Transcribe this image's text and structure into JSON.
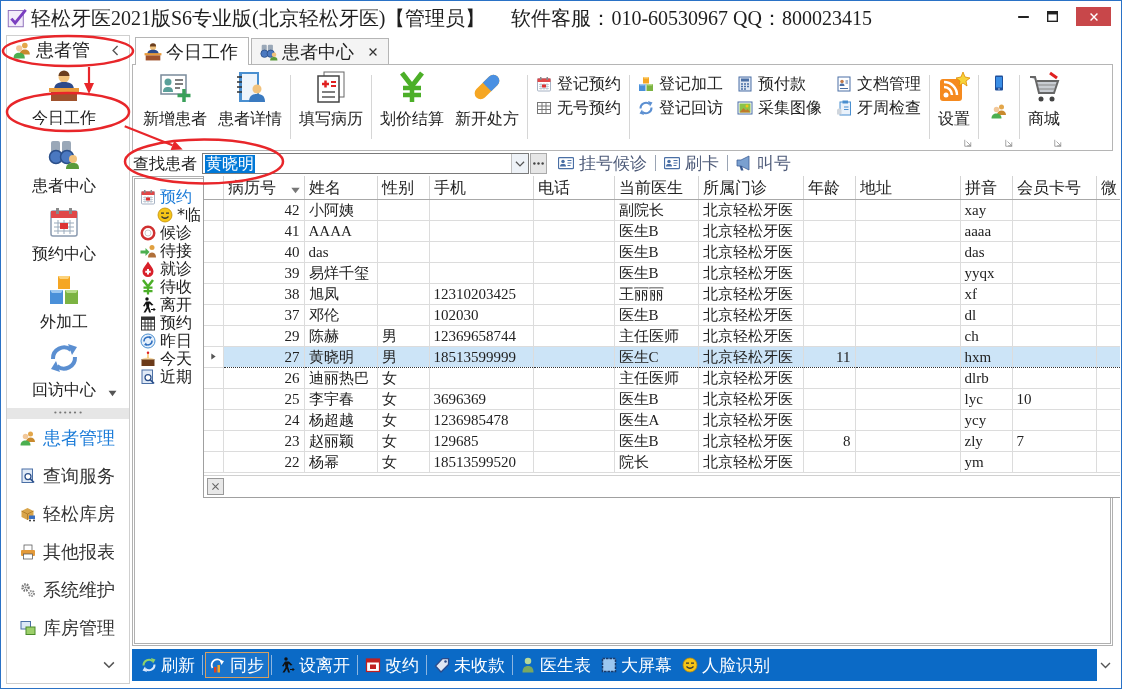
{
  "window": {
    "title": "轻松牙医2021版S6专业版(北京轻松牙医)【管理员】",
    "support": "软件客服：010-60530967 QQ：800023415"
  },
  "sidebar": {
    "title": "患者管",
    "shortcuts": [
      "今日工作",
      "患者中心",
      "预约中心",
      "外加工",
      "回访中心"
    ],
    "sections": [
      {
        "label": "患者管理",
        "selected": true
      },
      {
        "label": "查询服务",
        "selected": false
      },
      {
        "label": "轻松库房",
        "selected": false
      },
      {
        "label": "其他报表",
        "selected": false
      },
      {
        "label": "系统维护",
        "selected": false
      },
      {
        "label": "库房管理",
        "selected": false
      }
    ]
  },
  "tabs": [
    {
      "label": "今日工作",
      "selected": true,
      "closable": false
    },
    {
      "label": "患者中心",
      "selected": false,
      "closable": true
    }
  ],
  "ribbon": {
    "groups": [
      {
        "kind": "large",
        "buttons": [
          "新增患者",
          "患者详情"
        ]
      },
      {
        "kind": "large",
        "buttons": [
          "填写病历"
        ]
      },
      {
        "kind": "large",
        "buttons": [
          "划价结算",
          "新开处方"
        ]
      },
      {
        "kind": "small",
        "buttons": [
          "登记预约",
          "无号预约"
        ]
      },
      {
        "kind": "small",
        "buttons": [
          "登记加工",
          "登记回访",
          "预付款",
          "采集图像",
          "文档管理",
          "牙周检查"
        ]
      },
      {
        "kind": "large",
        "buttons": [
          "设置"
        ],
        "launcher": true
      },
      {
        "kind": "icons",
        "launcher": true
      },
      {
        "kind": "large",
        "buttons": [
          "商城"
        ],
        "launcher": true
      }
    ]
  },
  "search": {
    "label": "查找患者",
    "value": "黄晓明",
    "value_highlighted": true
  },
  "search_toolbar": [
    "挂号候诊",
    "刷卡",
    "叫号"
  ],
  "tree": [
    {
      "label": "预约",
      "selected": true,
      "children": [
        {
          "label": "*临",
          "selected": false
        }
      ]
    },
    {
      "label": "候诊",
      "selected": false
    },
    {
      "label": "待接",
      "selected": false
    },
    {
      "label": "就诊",
      "selected": false
    },
    {
      "label": "待收",
      "selected": false
    },
    {
      "label": "离开",
      "selected": false
    },
    {
      "label": "预约",
      "selected": false
    },
    {
      "label": "昨日",
      "selected": false
    },
    {
      "label": "今天",
      "selected": false
    },
    {
      "label": "近期",
      "selected": false
    }
  ],
  "grid": {
    "columns": [
      {
        "label": "病历号",
        "sorted_descending": true
      },
      {
        "label": "姓名",
        "sorted_descending": false
      },
      {
        "label": "性别",
        "sorted_descending": false
      },
      {
        "label": "手机",
        "sorted_descending": false
      },
      {
        "label": "电话",
        "sorted_descending": false
      },
      {
        "label": "当前医生",
        "sorted_descending": false
      },
      {
        "label": "所属门诊",
        "sorted_descending": false
      },
      {
        "label": "年龄",
        "sorted_descending": false
      },
      {
        "label": "地址",
        "sorted_descending": false
      },
      {
        "label": "拼音",
        "sorted_descending": false
      },
      {
        "label": "会员卡号",
        "sorted_descending": false
      },
      {
        "label": "微",
        "sorted_descending": false
      }
    ],
    "rows": [
      {
        "selected": false,
        "record_no": "42",
        "name": "小阿姨",
        "doctor": "副院长",
        "clinic": "北京轻松牙医",
        "pinyin": "xay"
      },
      {
        "selected": false,
        "record_no": "41",
        "name": "AAAA",
        "doctor": "医生B",
        "clinic": "北京轻松牙医",
        "pinyin": "aaaa"
      },
      {
        "selected": false,
        "record_no": "40",
        "name": "das",
        "doctor": "医生B",
        "clinic": "北京轻松牙医",
        "pinyin": "das"
      },
      {
        "selected": false,
        "record_no": "39",
        "name": "易烊千玺",
        "doctor": "医生B",
        "clinic": "北京轻松牙医",
        "pinyin": "yyqx"
      },
      {
        "selected": false,
        "record_no": "38",
        "name": "旭凤",
        "mobile": "12310203425",
        "doctor": "王丽丽",
        "clinic": "北京轻松牙医",
        "pinyin": "xf"
      },
      {
        "selected": false,
        "record_no": "37",
        "name": "邓伦",
        "mobile": "102030",
        "doctor": "医生B",
        "clinic": "北京轻松牙医",
        "pinyin": "dl"
      },
      {
        "selected": false,
        "record_no": "29",
        "name": "陈赫",
        "sex": "男",
        "mobile": "12369658744",
        "doctor": "主任医师",
        "clinic": "北京轻松牙医",
        "pinyin": "ch"
      },
      {
        "selected": true,
        "record_no": "27",
        "name": "黄晓明",
        "sex": "男",
        "mobile": "18513599999",
        "doctor": "医生C",
        "clinic": "北京轻松牙医",
        "age": "11",
        "pinyin": "hxm"
      },
      {
        "selected": false,
        "record_no": "26",
        "name": "迪丽热巴",
        "sex": "女",
        "doctor": "主任医师",
        "clinic": "北京轻松牙医",
        "pinyin": "dlrb"
      },
      {
        "selected": false,
        "record_no": "25",
        "name": "李宇春",
        "sex": "女",
        "mobile": "3696369",
        "doctor": "医生B",
        "clinic": "北京轻松牙医",
        "pinyin": "lyc",
        "member_card": "10"
      },
      {
        "selected": false,
        "record_no": "24",
        "name": "杨超越",
        "sex": "女",
        "mobile": "1236985478",
        "doctor": "医生A",
        "clinic": "北京轻松牙医",
        "pinyin": "ycy"
      },
      {
        "selected": false,
        "record_no": "23",
        "name": "赵丽颖",
        "sex": "女",
        "mobile": "129685",
        "doctor": "医生B",
        "clinic": "北京轻松牙医",
        "age": "8",
        "pinyin": "zly",
        "member_card": "7"
      },
      {
        "selected": false,
        "record_no": "22",
        "name": "杨幂",
        "sex": "女",
        "mobile": "18513599520",
        "doctor": "院长",
        "clinic": "北京轻松牙医",
        "pinyin": "ym"
      }
    ]
  },
  "bottom_toolbar": {
    "groups": [
      {
        "buttons": [
          {
            "label": "刷新",
            "pressed": false
          }
        ]
      },
      {
        "buttons": [
          {
            "label": "同步",
            "pressed": true
          }
        ]
      },
      {
        "buttons": [
          {
            "label": "设离开",
            "pressed": false
          }
        ]
      },
      {
        "buttons": [
          {
            "label": "改约",
            "pressed": false
          }
        ]
      },
      {
        "buttons": [
          {
            "label": "未收款",
            "pressed": false
          }
        ]
      },
      {
        "buttons": [
          {
            "label": "医生表",
            "pressed": false
          },
          {
            "label": "大屏幕",
            "pressed": false
          },
          {
            "label": "人脸识别",
            "pressed": false
          }
        ]
      }
    ]
  }
}
